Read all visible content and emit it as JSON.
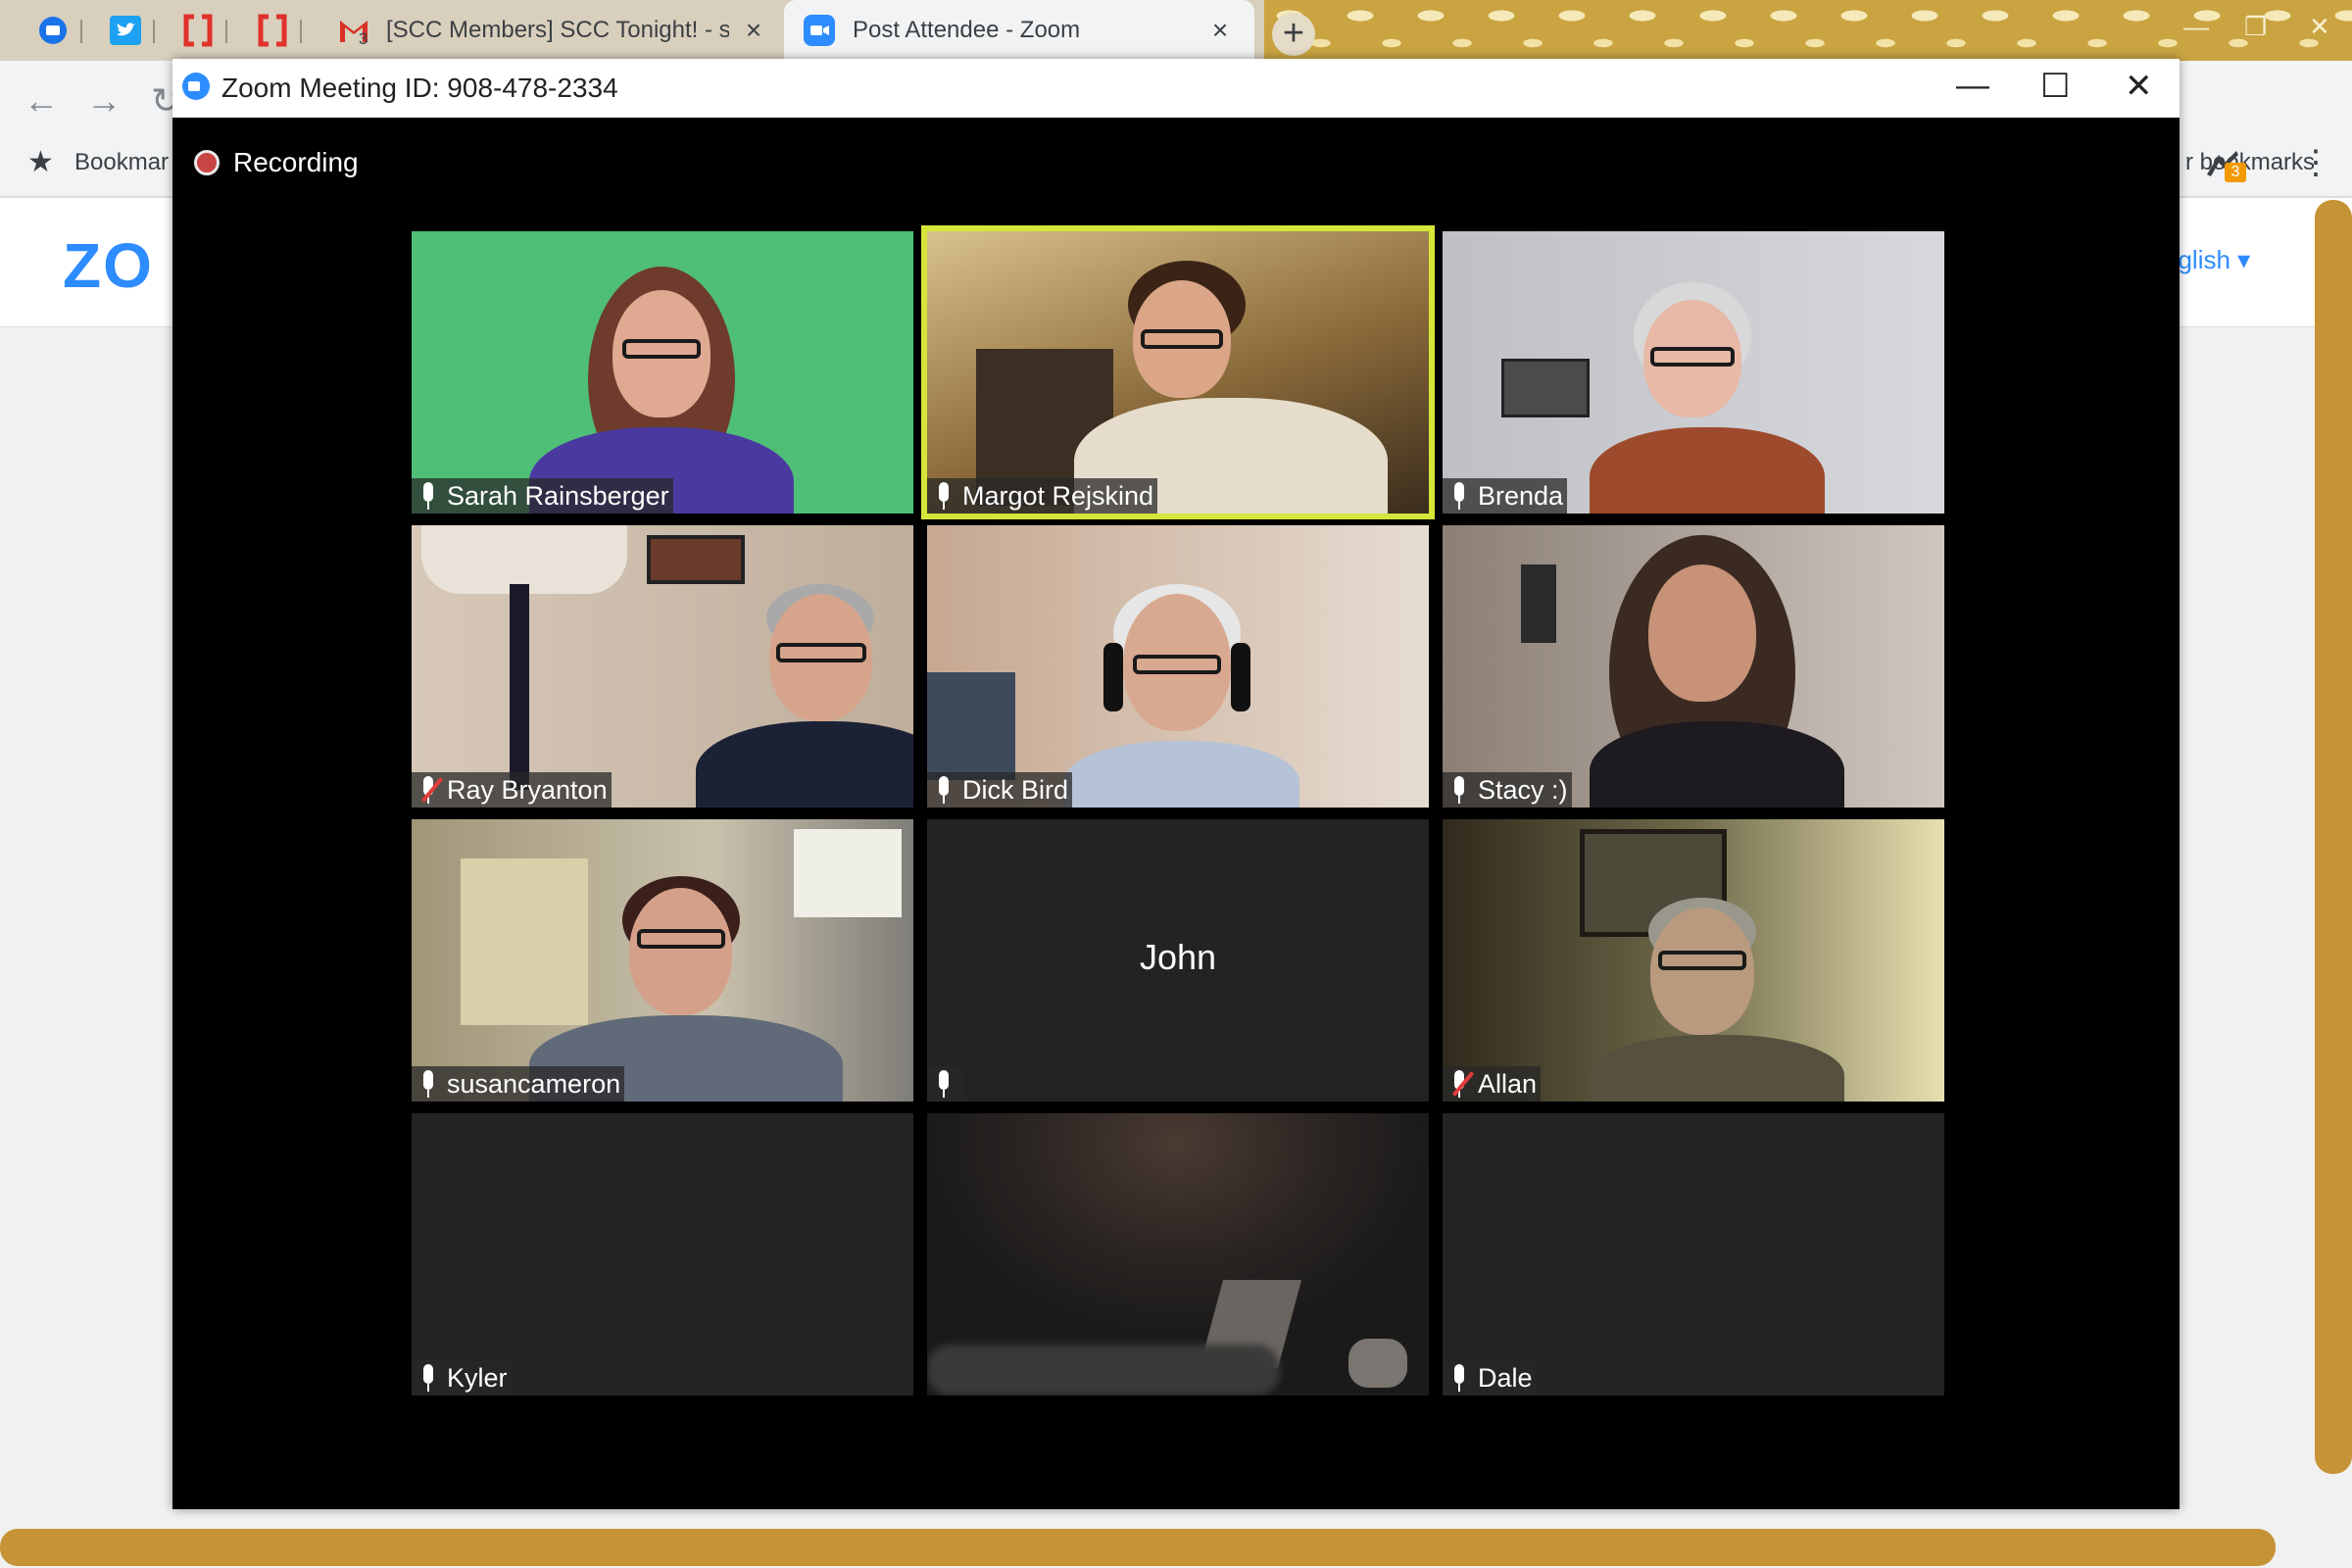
{
  "browser": {
    "tabs": [
      {
        "title": "[SCC Members] SCC Tonight! - sa",
        "close": "×"
      },
      {
        "title": "Post Attendee - Zoom",
        "close": "×"
      }
    ],
    "gmail_badge": "3",
    "new_tab": "+",
    "bookmarks_label": "Bookmar",
    "other_bookmarks": "r bookmarks",
    "extension_badge": "3"
  },
  "page": {
    "logo": "ZO",
    "language": "nglish ▾"
  },
  "zoom": {
    "window_title": "Zoom Meeting ID: 908-478-2334",
    "recording_label": "Recording",
    "participants": [
      {
        "name": "Sarah Rainsberger",
        "muted": false,
        "video": true,
        "active": false
      },
      {
        "name": "Margot Rejskind",
        "muted": false,
        "video": true,
        "active": true
      },
      {
        "name": "Brenda",
        "muted": false,
        "video": true,
        "active": false
      },
      {
        "name": "Ray Bryanton",
        "muted": true,
        "video": true,
        "active": false
      },
      {
        "name": "Dick Bird",
        "muted": false,
        "video": true,
        "active": false
      },
      {
        "name": "Stacy :)",
        "muted": false,
        "video": true,
        "active": false
      },
      {
        "name": "susancameron",
        "muted": false,
        "video": true,
        "active": false
      },
      {
        "name": "John",
        "muted": false,
        "video": false,
        "active": false
      },
      {
        "name": "Allan",
        "muted": true,
        "video": true,
        "active": false
      },
      {
        "name": "Kyler",
        "muted": false,
        "video": false,
        "active": false
      },
      {
        "name": "",
        "muted": false,
        "video": true,
        "active": false
      },
      {
        "name": "Dale",
        "muted": false,
        "video": false,
        "active": false
      }
    ]
  },
  "colors": {
    "zoom_blue": "#2d8cff",
    "active_speaker_border": "#d5e53a",
    "muted_red": "#e23b3b",
    "recording_dot": "#c94545"
  }
}
